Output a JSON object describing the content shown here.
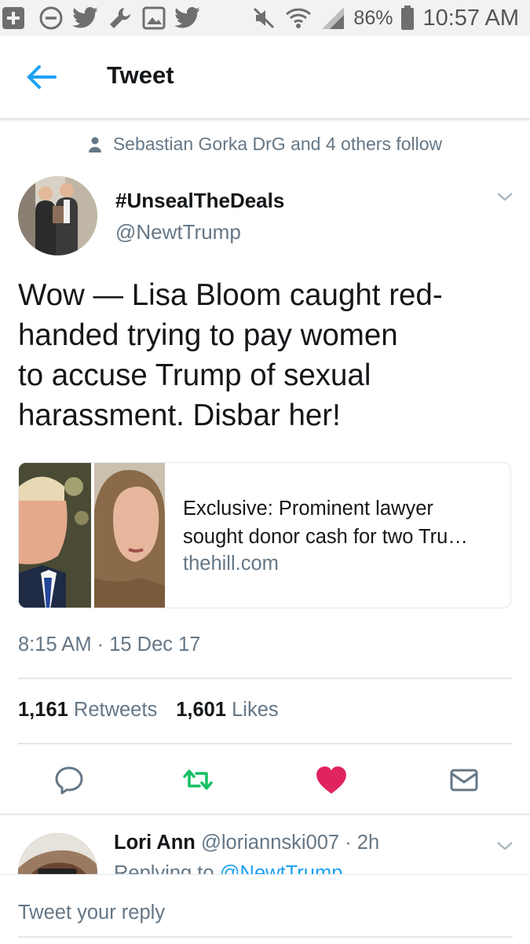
{
  "status_bar": {
    "battery": "86%",
    "time": "10:57 AM",
    "left_icons": [
      "plus-icon",
      "minus-circle-icon",
      "twitter-bird-icon",
      "wrench-icon",
      "image-icon",
      "twitter-bird-icon"
    ],
    "right_icons": [
      "mute-icon",
      "wifi-icon",
      "signal-icon",
      "battery-icon"
    ]
  },
  "header": {
    "title": "Tweet",
    "back_icon": "back-arrow-icon"
  },
  "social_context": {
    "text": "Sebastian Gorka DrG and 4 others follow",
    "icon": "person-icon"
  },
  "tweet": {
    "display_name": "#UnsealTheDeals",
    "handle": "@NewtTrump",
    "text_lines": [
      "Wow — Lisa Bloom caught red-",
      "handed trying to pay women",
      "to accuse Trump of sexual",
      "harassment. Disbar her!"
    ],
    "card": {
      "title_lines": [
        "Exclusive: Prominent lawyer",
        "sought donor cash for two Tru…"
      ],
      "domain": "thehill.com"
    },
    "timestamp": "8:15 AM · 15 Dec 17",
    "retweets_count": "1,161",
    "retweets_label": "Retweets",
    "likes_count": "1,601",
    "likes_label": "Likes",
    "actions": [
      "reply-icon",
      "retweet-icon",
      "like-icon",
      "dm-icon"
    ],
    "colors": {
      "retweet": "#17bf63",
      "like": "#e0245e",
      "accent": "#1da1f2"
    }
  },
  "reply": {
    "name": "Lori Ann",
    "handle": "@loriannski007",
    "time": "· 2h",
    "replying_to_label": "Replying to",
    "replying_to_handle": "@NewtTrump"
  },
  "composer": {
    "placeholder": "Tweet your reply"
  }
}
